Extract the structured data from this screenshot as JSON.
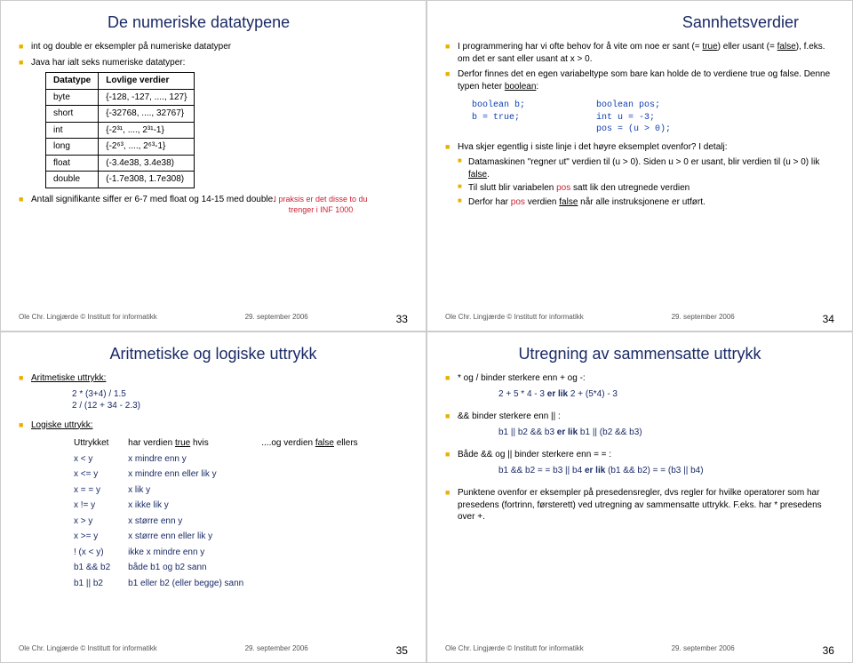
{
  "footer": {
    "author": "Ole Chr. Lingjærde © Institutt for informatikk",
    "date": "29. september 2006"
  },
  "s1": {
    "title": "De numeriske datatypene",
    "b1": "int og double er eksempler på numeriske datatyper",
    "b2": "Java har ialt seks numeriske datatyper:",
    "th1": "Datatype",
    "th2": "Lovlige verdier",
    "rows": [
      {
        "t": "byte",
        "v": "{-128, -127, ...., 127}"
      },
      {
        "t": "short",
        "v": "{-32768, ...., 32767}"
      },
      {
        "t": "int",
        "v": "{-2³¹, ...., 2³¹-1}"
      },
      {
        "t": "long",
        "v": "{-2⁶³, ...., 2⁶³-1}"
      },
      {
        "t": "float",
        "v": "(-3.4e38, 3.4e38)"
      },
      {
        "t": "double",
        "v": "(-1.7e308, 1.7e308)"
      }
    ],
    "annot": "I praksis er det disse to du trenger i INF 1000",
    "b3": "Antall signifikante siffer er 6-7 med float og 14-15 med double.",
    "page": "33"
  },
  "s2": {
    "title": "Sannhetsverdier",
    "b1a": "I programmering har vi ofte behov for å vite om noe er sant (= ",
    "b1b": "true",
    "b1c": ") eller usant (= ",
    "b1d": "false",
    "b1e": "), f.eks. om det er sant eller usant at x > 0.",
    "b2a": "Derfor finnes det en egen variabeltype som bare kan holde de to verdiene true og false.  Denne typen heter ",
    "b2b": "boolean",
    "b2c": ":",
    "code1a": "boolean b;",
    "code1b": "b = true;",
    "code2a": "boolean pos;",
    "code2b": "int u = -3;",
    "code2c": "pos = (u > 0);",
    "b3": "Hva skjer egentlig i siste linje i det høyre eksemplet ovenfor?  I detalj:",
    "sb1a": "Datamaskinen \"regner ut\" verdien til (u > 0).  Siden u > 0 er usant, blir verdien til (u > 0) lik ",
    "sb1b": "false",
    "sb1c": ".",
    "sb2a": "Til slutt blir variabelen ",
    "sb2b": "pos",
    "sb2c": " satt lik den utregnede verdien",
    "sb3a": "Derfor har ",
    "sb3b": " pos",
    "sb3c": " verdien ",
    "sb3d": "false",
    "sb3e": " når alle instruksjonene er utført.",
    "page": "34"
  },
  "s3": {
    "title": "Aritmetiske og logiske uttrykk",
    "h1": "Aritmetiske uttrykk:",
    "a1": "2 * (3+4) / 1.5",
    "a2": "2 / (12 + 34 - 2.3)",
    "h2": "Logiske uttrykk:",
    "colh1": "Uttrykket",
    "colh2a": "har verdien ",
    "colh2b": "true",
    "colh2c": " hvis",
    "colh3a": "....og verdien ",
    "colh3b": "false",
    "colh3c": " ellers",
    "rows": [
      {
        "e": "x < y",
        "d": "x mindre enn y"
      },
      {
        "e": "x <= y",
        "d": "x mindre enn eller lik y"
      },
      {
        "e": "x = = y",
        "d": "x lik y"
      },
      {
        "e": "x != y",
        "d": "x ikke lik y"
      },
      {
        "e": "x > y",
        "d": "x større enn y"
      },
      {
        "e": "x >= y",
        "d": "x større enn eller lik y"
      },
      {
        "e": "! (x < y)",
        "d": "ikke x mindre enn y"
      },
      {
        "e": "b1 && b2",
        "d": "både b1 og b2 sann"
      },
      {
        "e": "b1 || b2",
        "d": "b1 eller b2 (eller begge) sann"
      }
    ],
    "page": "35"
  },
  "s4": {
    "title": "Utregning av sammensatte uttrykk",
    "b1": "* og / binder sterkere enn  + og -:",
    "ex1a": "2 + 5 * 4 - 3  ",
    "ex1b": "er lik",
    "ex1c": "  2 + (5*4) - 3",
    "b2": "&& binder sterkere enn || :",
    "ex2a": "b1 || b2 && b3  ",
    "ex2b": "er lik",
    "ex2c": "  b1 || (b2 && b3)",
    "b3": "Både && og || binder sterkere enn = = :",
    "ex3a": "b1 && b2 = = b3 || b4  ",
    "ex3b": "er lik",
    "ex3c": "  (b1 && b2) = = (b3 || b4)",
    "b4": "Punktene ovenfor er eksempler på presedensregler, dvs regler for hvilke operatorer som har presedens (fortrinn, førsterett) ved utregning av sammensatte uttrykk.  F.eks. har * presedens over +.",
    "page": "36"
  }
}
